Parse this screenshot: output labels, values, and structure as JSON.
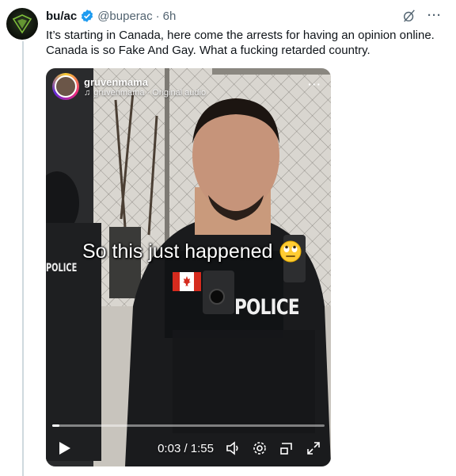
{
  "tweet": {
    "author_name": "bu/ac",
    "handle": "@buperac",
    "separator": "·",
    "time": "6h",
    "text": "It’s starting in Canada, here come the arrests for having an opinion online. Canada is so Fake And Gay. What a fucking retarded country.",
    "more_label": "···"
  },
  "video": {
    "ig_username": "gruvenmama",
    "ig_audio": "gruvenmama · Original audio",
    "ig_more": "···",
    "caption": "So this just happened",
    "badge_text": "POLICE",
    "side_badge_text": "POLICE",
    "progress": 0.027,
    "time_readout": "0:03 / 1:55",
    "icons": [
      "play-icon",
      "volume-icon",
      "settings-icon",
      "picture-in-picture-icon",
      "fullscreen-icon"
    ]
  },
  "colors": {
    "verified": "#1d9bf0",
    "text_primary": "#0f1419",
    "text_secondary": "#536471",
    "thread_line": "#cfd9de"
  }
}
